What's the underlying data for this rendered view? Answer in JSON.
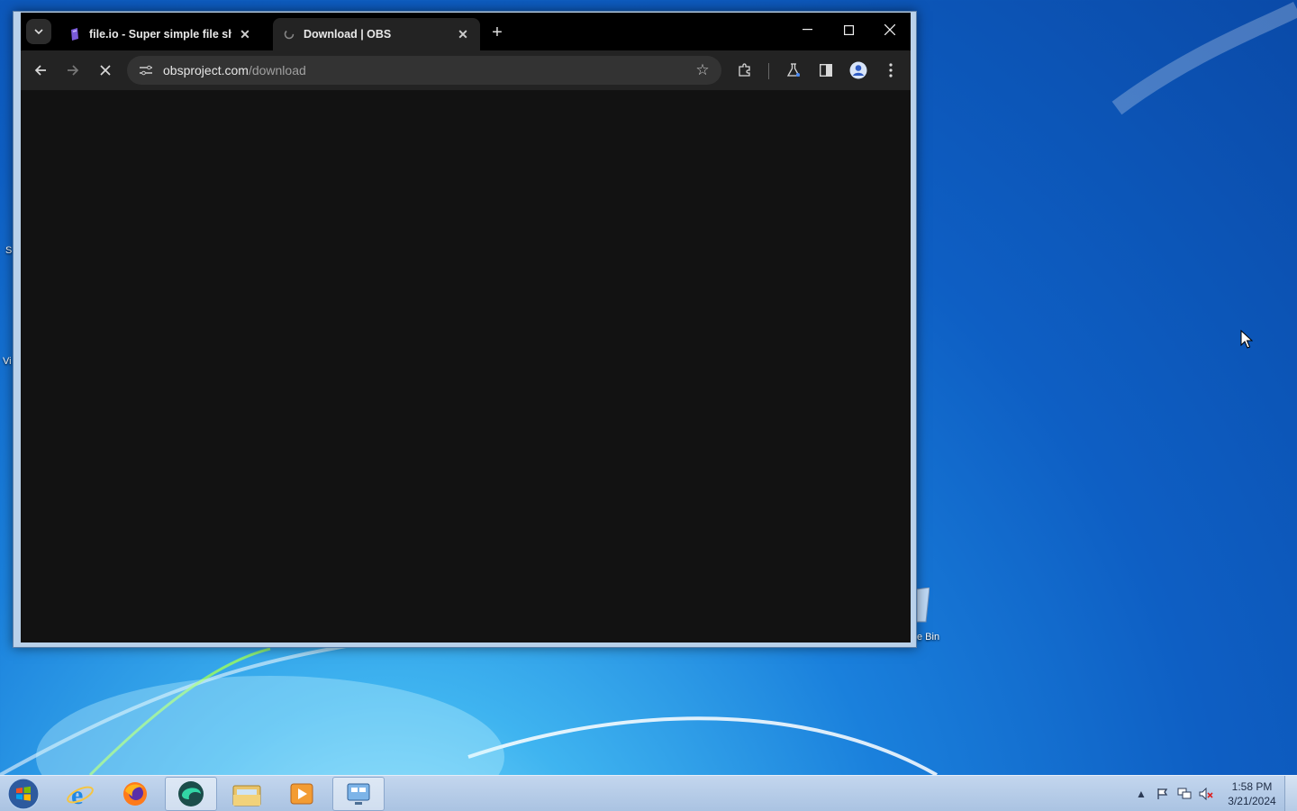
{
  "desktop": {
    "recycle_bin_label": "e Bin",
    "left_edge_fragments": [
      "S",
      "Vi"
    ]
  },
  "browser": {
    "tabs": [
      {
        "title": "file.io - Super simple file sharing",
        "active": false
      },
      {
        "title": "Download | OBS",
        "active": true
      }
    ],
    "new_tab_symbol": "+",
    "address": {
      "host": "obsproject.com",
      "path": "/download"
    },
    "loading": true
  },
  "taskbar": {
    "apps": [
      "start",
      "internet-explorer",
      "firefox",
      "browser-active",
      "file-explorer",
      "media-player",
      "remote-desktop"
    ],
    "clock": {
      "time": "1:58 PM",
      "date": "3/21/2024"
    }
  },
  "colors": {
    "chrome_tabstrip": "#000000",
    "chrome_toolbar": "#232323",
    "page_background": "#121212",
    "taskbar": "#aac3e2"
  }
}
